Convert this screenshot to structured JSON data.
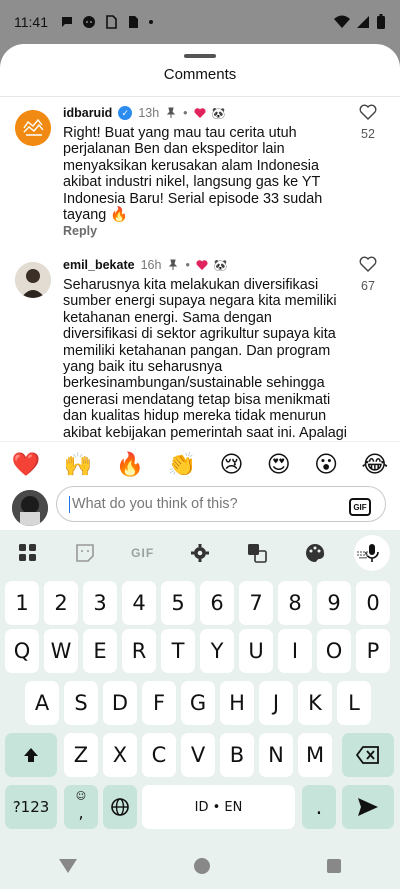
{
  "status_bar": {
    "time": "11:41"
  },
  "sheet": {
    "title": "Comments"
  },
  "comments": [
    {
      "user": "idbaruid",
      "verified": true,
      "time": "13h",
      "text": "Right! Buat yang mau tau cerita utuh perjalanan Ben dan ekspeditor lain menyaksikan kerusakan alam Indonesia akibat industri nikel, langsung gas ke YT Indonesia Baru! Serial episode 33 sudah tayang 🔥",
      "reply_label": "Reply",
      "likes": "52",
      "badge_emoji": "🐼"
    },
    {
      "user": "emil_bekate",
      "verified": false,
      "time": "16h",
      "text": "Seharusnya kita melakukan diversifikasi sumber energi supaya negara kita memiliki ketahanan energi. Sama dengan diversifikasi di sektor agrikultur supaya kita memiliki ketahanan pangan. Dan program yang baik itu seharusnya berkesinambungan/sustainable sehingga generasi mendatang tetap bisa menikmati dan kualitas hidup mereka tidak menurun akibat kebijakan pemerintah saat ini. Apalagi disaat dunia yang sekarang ini",
      "likes": "67",
      "badge_emoji": "🐼"
    }
  ],
  "emoji_reactions": [
    "❤️",
    "🙌",
    "🔥",
    "👏",
    "😢",
    "😍",
    "😮",
    "😂"
  ],
  "input": {
    "placeholder": "What do you think of this?",
    "gif_label": "GIF"
  },
  "keyboard": {
    "toolbar": {
      "gif_label": "GIF"
    },
    "number_row": [
      "1",
      "2",
      "3",
      "4",
      "5",
      "6",
      "7",
      "8",
      "9",
      "0"
    ],
    "row1": [
      "Q",
      "W",
      "E",
      "R",
      "T",
      "Y",
      "U",
      "I",
      "O",
      "P"
    ],
    "row2": [
      "A",
      "S",
      "D",
      "F",
      "G",
      "H",
      "J",
      "K",
      "L"
    ],
    "row3": [
      "Z",
      "X",
      "C",
      "V",
      "B",
      "N",
      "M"
    ],
    "symbols_label": "?123",
    "comma_label": ",",
    "space_label": "ID • EN",
    "period_label": "."
  },
  "colors": {
    "heart": "#e0245e",
    "accent_key": "#c6e4d9",
    "keyboard_bg": "#e8f1ee"
  }
}
